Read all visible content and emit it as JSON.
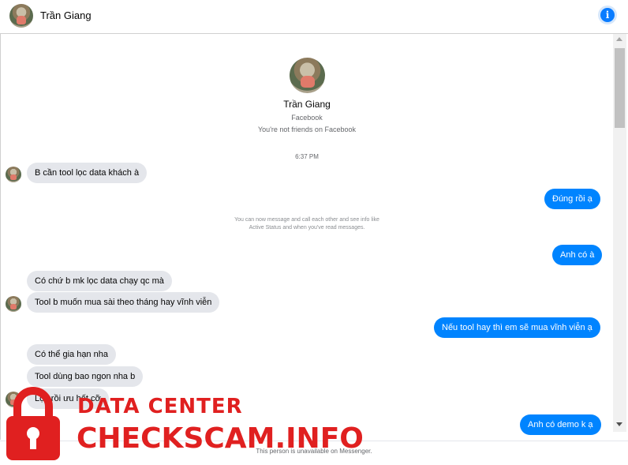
{
  "header": {
    "contact_name": "Trần Giang",
    "info_icon": "info-icon"
  },
  "profile": {
    "name": "Trần Giang",
    "source": "Facebook",
    "relationship": "You're not friends on Facebook"
  },
  "thread": {
    "timestamp": "6:37 PM",
    "system_note": "You can now message and call each other and see info like Active Status and when you've read messages.",
    "messages": [
      {
        "from": "them",
        "text": "B cần tool lọc data khách à"
      },
      {
        "from": "me",
        "text": "Đúng rồi ạ"
      },
      {
        "from": "me",
        "text": "Anh có à"
      },
      {
        "from": "them",
        "text": "Có chứ b mk lọc data chạy qc mà"
      },
      {
        "from": "them",
        "text": "Tool b muốn mua sài theo tháng hay vĩnh viễn"
      },
      {
        "from": "me",
        "text": "Nếu tool hay thì em sẽ mua vĩnh viễn ạ"
      },
      {
        "from": "them",
        "text": "Có thể gia hạn nha"
      },
      {
        "from": "them",
        "text": "Tool dùng bao ngon nha b"
      },
      {
        "from": "them",
        "text": "Lọc rồi ưu hết cỡ"
      },
      {
        "from": "me",
        "text": "Anh có demo k ạ"
      }
    ]
  },
  "footer": {
    "note": "This person is unavailable on Messenger."
  },
  "watermark": {
    "line1": "DATA CENTER",
    "line2": "CHECKSCAM.INFO"
  },
  "colors": {
    "outgoing_bubble": "#0084ff",
    "incoming_bubble": "#e4e6eb",
    "watermark": "#e02020",
    "info_button": "#0a7cff"
  }
}
